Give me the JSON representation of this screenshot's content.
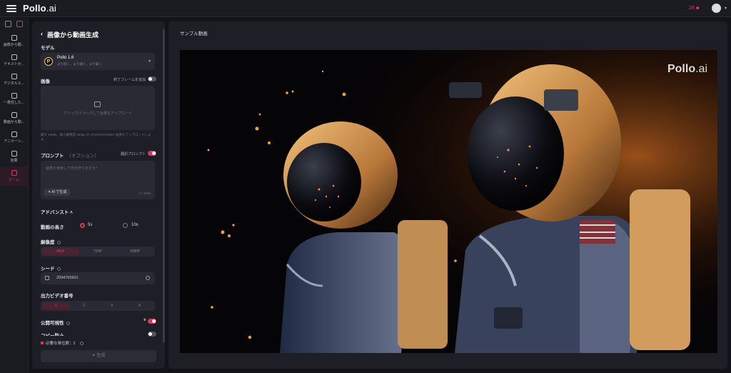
{
  "topbar": {
    "logo_main": "Pollo",
    "logo_ai": ".ai",
    "credits": "28"
  },
  "rail": {
    "items": [
      {
        "label": "画像から動..."
      },
      {
        "label": "テキストか..."
      },
      {
        "label": "デジタルヒ..."
      },
      {
        "label": "一貫性した..."
      },
      {
        "label": "動画から動..."
      },
      {
        "label": "アニメーシ..."
      },
      {
        "label": "効果"
      },
      {
        "label": "ホーム"
      }
    ]
  },
  "panel": {
    "title": "画像から動画生成",
    "model_label": "モデル",
    "model_name": "Pollo 1.6",
    "model_desc": "より良く、より速く、より安く",
    "image_label": "画像",
    "end_frame_label": "終了フレームを追加",
    "upload_text": "クリック/ドラッグして画像をアップロード",
    "upload_hint": "最大 10MB、最小解像度 300px の JPG/PNG/WEBP 画像をアップロードします。",
    "prompt_label": "プロンプト",
    "prompt_optional": "（オプション）",
    "prompt_enhance_label": "翻訳プロンプト",
    "prompt_placeholder": "画像を使用して何を作りますか？",
    "ai_button": "AI で生成",
    "prompt_counter": "0 / 1500",
    "advanced_label": "アドバンスト",
    "duration_label": "動画の長さ",
    "duration_5s": "5s",
    "duration_10s": "10s",
    "resolution_label": "解像度",
    "resolutions": [
      "480P",
      "720P",
      "1080P"
    ],
    "seed_label": "シード",
    "seed_value": "2094765901",
    "output_count_label": "出力ビデオ番号",
    "output_counts": [
      "1",
      "2",
      "3",
      "4"
    ],
    "visibility_label": "公開可視性",
    "copy_protect_label": "コピー防止",
    "required_credits": "必要な単位数：2",
    "generate_button": "生成"
  },
  "preview": {
    "title": "サンプル動画",
    "watermark_main": "Pollo",
    "watermark_ai": ".ai"
  },
  "colors": {
    "accent": "#e0335d",
    "panel": "#1e1e26",
    "background": "#131319"
  }
}
